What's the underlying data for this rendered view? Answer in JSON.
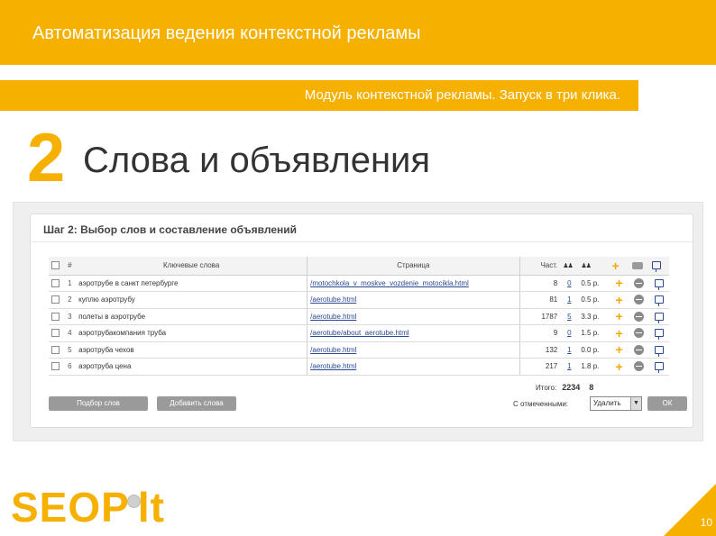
{
  "header": {
    "title": "Автоматизация ведения контекстной рекламы",
    "subtitle": "Модуль контекстной рекламы. Запуск в три клика."
  },
  "step": {
    "number": "2",
    "title": "Слова и объявления"
  },
  "panel": {
    "heading": "Шаг 2: Выбор слов и составление объявлений",
    "columns": {
      "num": "#",
      "keywords": "Ключевые слова",
      "page": "Страница",
      "freq": "Част."
    },
    "rows": [
      {
        "num": "1",
        "keyword": "аэротрубе в санкт петербурге",
        "page": "/motochkola_v_moskve_vozdenie_motocikla.html",
        "freq": "8",
        "clicks": "0",
        "price": "0.5 р."
      },
      {
        "num": "2",
        "keyword": "куплю аэротрубу",
        "page": "/aerotube.html",
        "freq": "81",
        "clicks": "1",
        "price": "0.5 р."
      },
      {
        "num": "3",
        "keyword": "полеты в аэротрубе",
        "page": "/aerotube.html",
        "freq": "1787",
        "clicks": "5",
        "price": "3.3 р."
      },
      {
        "num": "4",
        "keyword": "аэротрубакомпания труба",
        "page": "/aerotube/about_aerotube.html",
        "freq": "9",
        "clicks": "0",
        "price": "1.5 р."
      },
      {
        "num": "5",
        "keyword": "аэротруба чехов",
        "page": "/aerotube.html",
        "freq": "132",
        "clicks": "1",
        "price": "0.0 р."
      },
      {
        "num": "6",
        "keyword": "аэротруба цена",
        "page": "/aerotube.html",
        "freq": "217",
        "clicks": "1",
        "price": "1.8 р."
      }
    ],
    "total_label": "Итого:",
    "total_value": "2234",
    "total_count": "8",
    "buttons": {
      "pick": "Подбор слов",
      "add": "Добавить слова",
      "ok": "ОК"
    },
    "selected_label": "С отмеченными:",
    "selected_value": "Удалить"
  },
  "footer": {
    "logo": "SEOPult",
    "page": "10"
  },
  "colors": {
    "accent": "#f5b000",
    "link": "#2b4a93",
    "button": "#9a9a9a"
  }
}
